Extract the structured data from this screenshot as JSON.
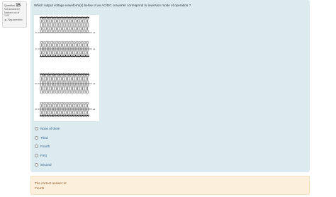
{
  "question_info": {
    "label": "Question",
    "number": "15",
    "status": "Not answered",
    "marked": "Marked out of",
    "points": "1.00",
    "flag_label": "Flag question"
  },
  "question": {
    "text": "Which output voltage waveform(s) below of an AC/DC converter correspond to inversion mode of operation ?"
  },
  "figure": {
    "labels": {
      "axis_zero": "0",
      "axis_omega_t": "ωt"
    }
  },
  "answers": [
    {
      "label": "None of them"
    },
    {
      "label": "Third"
    },
    {
      "label": "Fourth"
    },
    {
      "label": "First"
    },
    {
      "label": "Second"
    }
  ],
  "feedback": {
    "line1": "The correct answer is:",
    "line2": "Fourth"
  },
  "colors": {
    "panel_bg": "#dcebef",
    "feedback_bg": "#fcefdc",
    "link": "#2b5a8a"
  }
}
